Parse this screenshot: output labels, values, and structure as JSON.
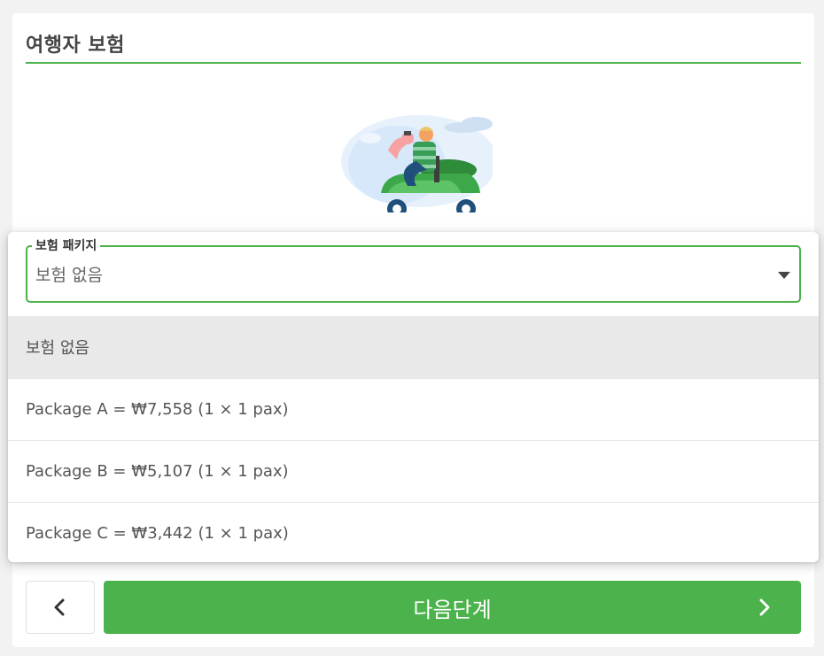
{
  "section": {
    "title": "여행자 보험"
  },
  "insurance_select": {
    "legend": "보험 패키지",
    "value": "보험 없음",
    "options": [
      "보험 없음",
      "Package A = ₩7,558 (1 × 1 pax)",
      "Package B = ₩5,107 (1 × 1 pax)",
      "Package C = ₩3,442 (1 × 1 pax)"
    ]
  },
  "nav": {
    "next_label": "다음단계"
  },
  "colors": {
    "accent": "#4cb24b",
    "highlight": "#e9e9e9"
  },
  "icons": [
    "scooter-illustration",
    "caret-down-icon",
    "chevron-left-icon",
    "chevron-right-icon"
  ]
}
